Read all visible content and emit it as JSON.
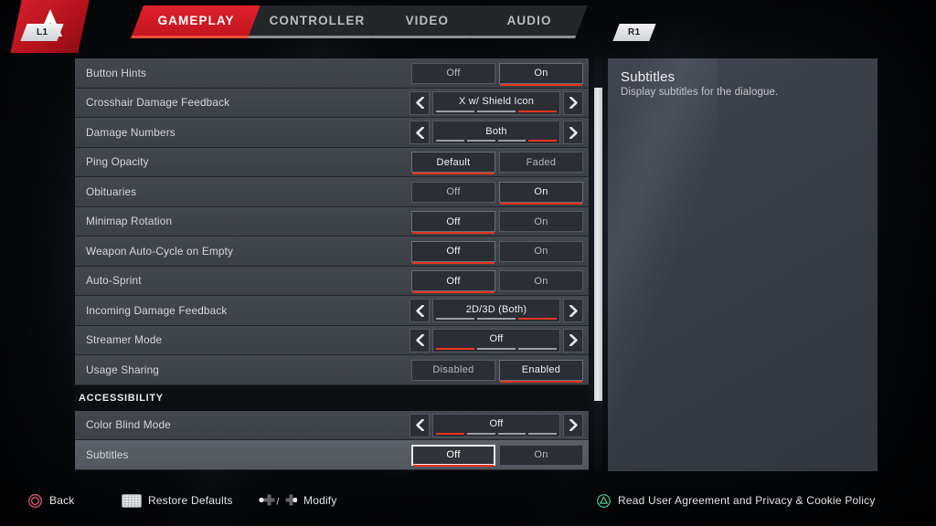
{
  "app": {
    "logo_icon": "apex-legends-logo"
  },
  "tabs": {
    "bumper_left": "L1",
    "bumper_right": "R1",
    "items": [
      {
        "label": "GAMEPLAY",
        "active": true
      },
      {
        "label": "CONTROLLER",
        "active": false
      },
      {
        "label": "VIDEO",
        "active": false
      },
      {
        "label": "AUDIO",
        "active": false
      }
    ]
  },
  "settings": [
    {
      "kind": "toggle",
      "label": "Button Hints",
      "options": [
        "Off",
        "On"
      ],
      "selected": 1,
      "cursor": -1
    },
    {
      "kind": "selector",
      "label": "Crosshair Damage Feedback",
      "value": "X w/ Shield Icon",
      "segments": 3,
      "active_segment": 2
    },
    {
      "kind": "selector",
      "label": "Damage Numbers",
      "value": "Both",
      "segments": 4,
      "active_segment": 3
    },
    {
      "kind": "toggle",
      "label": "Ping Opacity",
      "options": [
        "Default",
        "Faded"
      ],
      "selected": 0,
      "cursor": -1
    },
    {
      "kind": "toggle",
      "label": "Obituaries",
      "options": [
        "Off",
        "On"
      ],
      "selected": 1,
      "cursor": -1
    },
    {
      "kind": "toggle",
      "label": "Minimap Rotation",
      "options": [
        "Off",
        "On"
      ],
      "selected": 0,
      "cursor": -1
    },
    {
      "kind": "toggle",
      "label": "Weapon Auto-Cycle on Empty",
      "options": [
        "Off",
        "On"
      ],
      "selected": 0,
      "cursor": -1
    },
    {
      "kind": "toggle",
      "label": "Auto-Sprint",
      "options": [
        "Off",
        "On"
      ],
      "selected": 0,
      "cursor": -1
    },
    {
      "kind": "selector",
      "label": "Incoming Damage Feedback",
      "value": "2D/3D (Both)",
      "segments": 3,
      "active_segment": 2
    },
    {
      "kind": "selector",
      "label": "Streamer Mode",
      "value": "Off",
      "segments": 3,
      "active_segment": 0
    },
    {
      "kind": "toggle",
      "label": "Usage Sharing",
      "options": [
        "Disabled",
        "Enabled"
      ],
      "selected": 1,
      "cursor": -1
    },
    {
      "kind": "section",
      "label": "ACCESSIBILITY"
    },
    {
      "kind": "selector",
      "label": "Color Blind Mode",
      "value": "Off",
      "segments": 4,
      "active_segment": 0
    },
    {
      "kind": "toggle",
      "label": "Subtitles",
      "row_selected": true,
      "options": [
        "Off",
        "On"
      ],
      "selected": 0,
      "cursor": 0
    }
  ],
  "info": {
    "title": "Subtitles",
    "description": "Display subtitles for the dialogue."
  },
  "footer": {
    "back": {
      "label": "Back",
      "icon": "ps-circle-button-icon"
    },
    "restore": {
      "label": "Restore Defaults",
      "icon": "ps-touchpad-icon"
    },
    "modify": {
      "label": "Modify",
      "icon": "dpad-left-right-icon"
    },
    "policy": {
      "label": "Read User Agreement and Privacy & Cookie Policy",
      "icon": "ps-triangle-button-icon"
    }
  },
  "colors": {
    "accent_red": "#e8321f",
    "brand_red": "#d5202a",
    "row_bg": "#3f434a",
    "row_selected_bg": "#565b63",
    "panel_bg": "#3a3e47",
    "policy_green": "#4fbf8a"
  },
  "scrollbar": {
    "thumb_top_pct": 7,
    "thumb_height_pct": 76
  }
}
